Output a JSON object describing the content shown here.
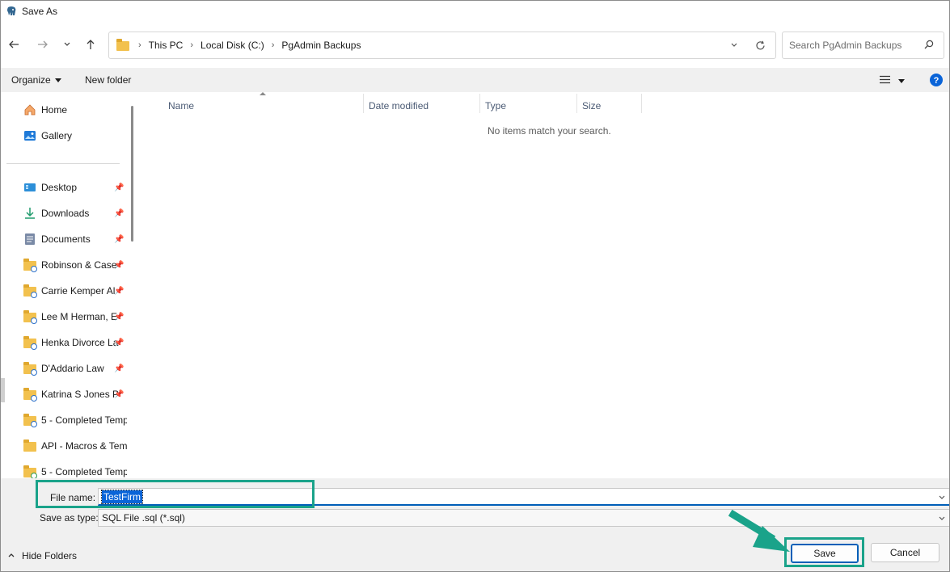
{
  "window": {
    "title": "Save As"
  },
  "nav": {
    "breadcrumb": [
      "This PC",
      "Local Disk (C:)",
      "PgAdmin Backups"
    ],
    "search_placeholder": "Search PgAdmin Backups"
  },
  "commands": {
    "organize": "Organize",
    "new_folder": "New folder"
  },
  "sidebar": {
    "quick": [
      {
        "label": "Home"
      },
      {
        "label": "Gallery"
      }
    ],
    "items": [
      {
        "label": "Desktop",
        "pinned": true
      },
      {
        "label": "Downloads",
        "pinned": true
      },
      {
        "label": "Documents",
        "pinned": true
      },
      {
        "label": "Robinson & Case",
        "pinned": true
      },
      {
        "label": "Carrie Kemper Al",
        "pinned": true
      },
      {
        "label": "Lee M Herman, E",
        "pinned": true
      },
      {
        "label": "Henka Divorce La",
        "pinned": true
      },
      {
        "label": "D'Addario Law",
        "pinned": true
      },
      {
        "label": "Katrina S Jones P",
        "pinned": true
      },
      {
        "label": "5 - Completed Temp",
        "pinned": false
      },
      {
        "label": "API - Macros & Tem",
        "pinned": false
      },
      {
        "label": "5 - Completed Temp",
        "pinned": false
      }
    ]
  },
  "columns": [
    "Name",
    "Date modified",
    "Type",
    "Size"
  ],
  "content": {
    "empty_message": "No items match your search."
  },
  "form": {
    "filename_label": "File name:",
    "filename_value": "TestFirm",
    "filetype_label": "Save as type:",
    "filetype_value": "SQL File .sql (*.sql)"
  },
  "footer": {
    "hide_folders": "Hide Folders",
    "save": "Save",
    "cancel": "Cancel"
  },
  "colors": {
    "annotation": "#1aa38a",
    "accent": "#005fb8",
    "folder": "#f2c14e"
  }
}
